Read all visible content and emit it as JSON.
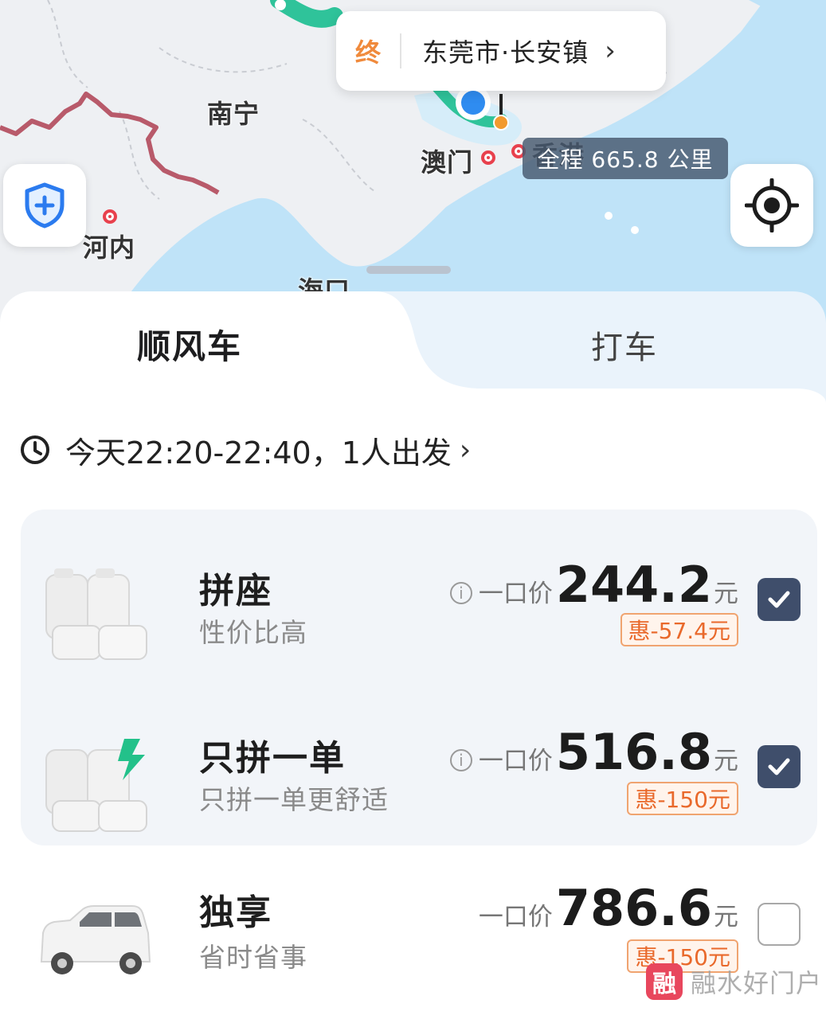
{
  "map": {
    "labels": {
      "nanning": "南宁",
      "hanoi": "河内",
      "macau": "澳门",
      "hongkong": "香港",
      "haikou": "海口"
    },
    "destination": {
      "tag": "终",
      "name": "东莞市·长安镇",
      "chevron": "›"
    },
    "distance_badge": "全程 665.8 公里",
    "icons": {
      "safety": "shield-plus-icon",
      "locate": "crosshair-icon"
    },
    "colors": {
      "sea": "#bfe3f8",
      "land": "#eef0f3",
      "border": "#b85a6a",
      "route": "#2fc39a",
      "pin": "#2f8cf0"
    }
  },
  "tabs": [
    {
      "label": "顺风车",
      "active": true
    },
    {
      "label": "打车",
      "active": false
    }
  ],
  "schedule": {
    "text": "今天22:20-22:40，1人出发",
    "chevron": "›"
  },
  "options": [
    {
      "title": "拼座",
      "subtitle": "性价比高",
      "price_prefix": "一口价",
      "price": "244.2",
      "unit": "元",
      "discount": "惠-57.4元",
      "checked": true,
      "info": "i"
    },
    {
      "title": "只拼一单",
      "subtitle": "只拼一单更舒适",
      "price_prefix": "一口价",
      "price": "516.8",
      "unit": "元",
      "discount": "惠-150元",
      "checked": true,
      "info": "i"
    },
    {
      "title": "独享",
      "subtitle": "省时省事",
      "price_prefix": "一口价",
      "price": "786.6",
      "unit": "元",
      "discount": "惠-150元",
      "checked": false
    }
  ],
  "watermark": {
    "badge": "融",
    "text": "融水好门户"
  },
  "colors": {
    "accent_check": "#3f4e6b",
    "discount": "#e9692b",
    "lightning": "#23c18a"
  }
}
